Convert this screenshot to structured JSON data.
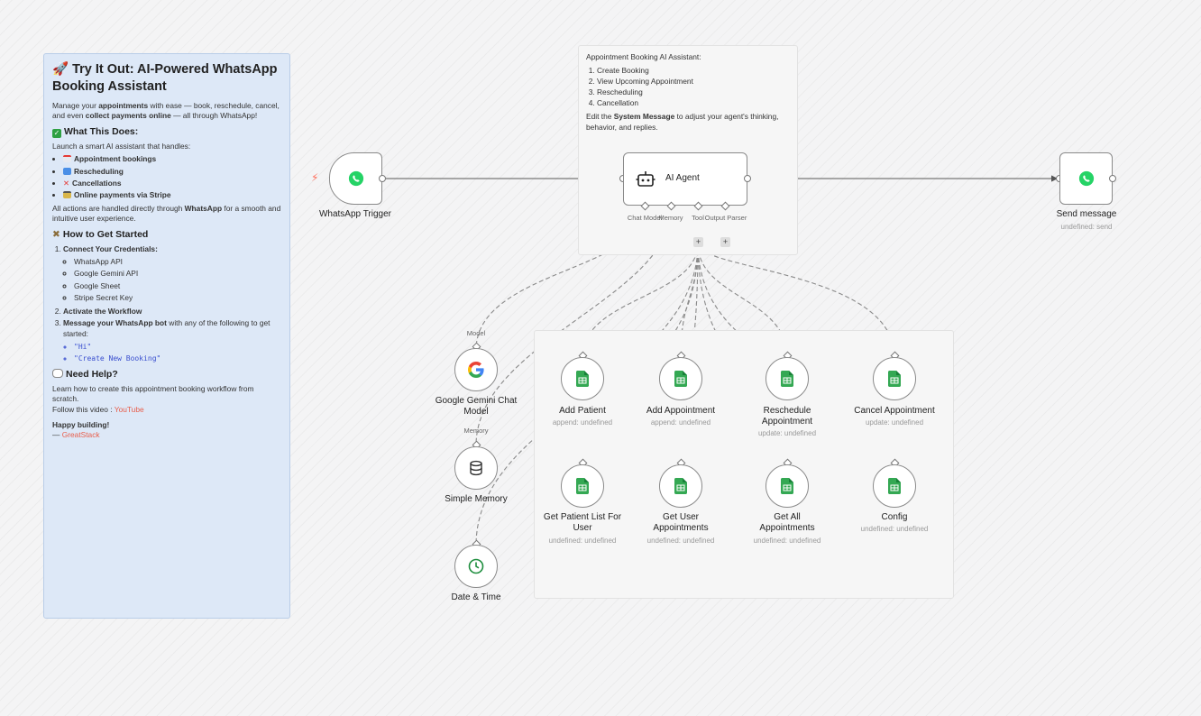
{
  "sticky_main": {
    "title": "🚀 Try It Out: AI-Powered WhatsApp Booking Assistant",
    "intro_1": "Manage your ",
    "intro_b1": "appointments",
    "intro_2": " with ease — book, reschedule, cancel, and even ",
    "intro_b2": "collect payments online",
    "intro_3": " — all through WhatsApp!",
    "what_heading": "What This Does:",
    "launch_text": "Launch a smart AI assistant that handles:",
    "features": [
      "Appointment bookings",
      "Rescheduling",
      "Cancellations",
      "Online payments via Stripe"
    ],
    "all_actions_1": "All actions are handled directly through ",
    "all_actions_b": "WhatsApp",
    "all_actions_2": " for a smooth and intuitive user experience.",
    "how_heading": "How to Get Started",
    "step1": "Connect Your Credentials:",
    "credentials": [
      "WhatsApp API",
      "Google Gemini API",
      "Google Sheet",
      "Stripe Secret Key"
    ],
    "step2": "Activate the Workflow",
    "step3_b": "Message your WhatsApp bot",
    "step3_rest": " with any of the following to get started:",
    "messages": [
      "\"Hi\"",
      "\"Create New Booking\""
    ],
    "help_heading": "Need Help?",
    "help_text": "Learn how to create this appointment booking workflow from scratch.",
    "follow_text": "Follow this video : ",
    "follow_link": "YouTube",
    "happy": "Happy building!",
    "sign_dash": "— ",
    "sign_name": "GreatStack"
  },
  "sticky_agent": {
    "title": "Appointment Booking AI Assistant:",
    "items": [
      "Create Booking",
      "View Upcoming Appointment",
      "Rescheduling",
      "Cancellation"
    ],
    "edit_1": "Edit the ",
    "edit_b": "System Message",
    "edit_2": " to adjust your agent's thinking, behavior, and replies."
  },
  "nodes": {
    "trigger": {
      "label": "WhatsApp Trigger"
    },
    "agent": {
      "label": "AI Agent",
      "ports": [
        "Chat Model",
        "Memory",
        "Tool",
        "Output Parser"
      ]
    },
    "send": {
      "label": "Send message",
      "sub": "undefined: send"
    },
    "gemini": {
      "label": "Google Gemini Chat Model",
      "port": "Model"
    },
    "memory": {
      "label": "Simple Memory",
      "port": "Memory"
    },
    "datetime": {
      "label": "Date & Time"
    },
    "sheets": [
      {
        "label": "Add Patient",
        "sub": "append: undefined"
      },
      {
        "label": "Add Appointment",
        "sub": "append: undefined"
      },
      {
        "label": "Reschedule Appointment",
        "sub": "update: undefined"
      },
      {
        "label": "Cancel Appointment",
        "sub": "update: undefined"
      },
      {
        "label": "Get Patient List For User",
        "sub": "undefined: undefined"
      },
      {
        "label": "Get User Appointments",
        "sub": "undefined: undefined"
      },
      {
        "label": "Get All Appointments",
        "sub": "undefined: undefined"
      },
      {
        "label": "Config",
        "sub": "undefined: undefined"
      }
    ]
  },
  "colors": {
    "whatsapp": "#25d366",
    "sheets": "#34a853",
    "clock": "#1e8e3e",
    "link": "#e85d4a",
    "trigger_bolt": "#ff6d5a"
  }
}
